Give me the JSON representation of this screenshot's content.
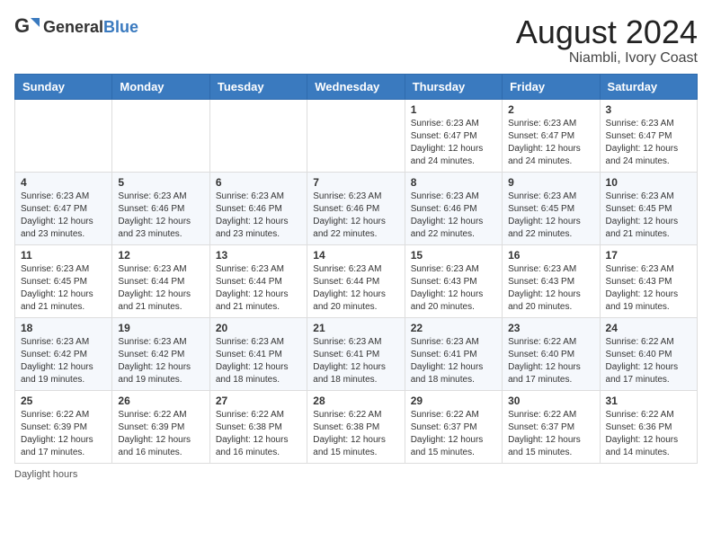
{
  "header": {
    "logo_general": "General",
    "logo_blue": "Blue",
    "main_title": "August 2024",
    "subtitle": "Niambli, Ivory Coast"
  },
  "days_of_week": [
    "Sunday",
    "Monday",
    "Tuesday",
    "Wednesday",
    "Thursday",
    "Friday",
    "Saturday"
  ],
  "weeks": [
    [
      {
        "day": "",
        "info": ""
      },
      {
        "day": "",
        "info": ""
      },
      {
        "day": "",
        "info": ""
      },
      {
        "day": "",
        "info": ""
      },
      {
        "day": "1",
        "info": "Sunrise: 6:23 AM\nSunset: 6:47 PM\nDaylight: 12 hours\nand 24 minutes."
      },
      {
        "day": "2",
        "info": "Sunrise: 6:23 AM\nSunset: 6:47 PM\nDaylight: 12 hours\nand 24 minutes."
      },
      {
        "day": "3",
        "info": "Sunrise: 6:23 AM\nSunset: 6:47 PM\nDaylight: 12 hours\nand 24 minutes."
      }
    ],
    [
      {
        "day": "4",
        "info": "Sunrise: 6:23 AM\nSunset: 6:47 PM\nDaylight: 12 hours\nand 23 minutes."
      },
      {
        "day": "5",
        "info": "Sunrise: 6:23 AM\nSunset: 6:46 PM\nDaylight: 12 hours\nand 23 minutes."
      },
      {
        "day": "6",
        "info": "Sunrise: 6:23 AM\nSunset: 6:46 PM\nDaylight: 12 hours\nand 23 minutes."
      },
      {
        "day": "7",
        "info": "Sunrise: 6:23 AM\nSunset: 6:46 PM\nDaylight: 12 hours\nand 22 minutes."
      },
      {
        "day": "8",
        "info": "Sunrise: 6:23 AM\nSunset: 6:46 PM\nDaylight: 12 hours\nand 22 minutes."
      },
      {
        "day": "9",
        "info": "Sunrise: 6:23 AM\nSunset: 6:45 PM\nDaylight: 12 hours\nand 22 minutes."
      },
      {
        "day": "10",
        "info": "Sunrise: 6:23 AM\nSunset: 6:45 PM\nDaylight: 12 hours\nand 21 minutes."
      }
    ],
    [
      {
        "day": "11",
        "info": "Sunrise: 6:23 AM\nSunset: 6:45 PM\nDaylight: 12 hours\nand 21 minutes."
      },
      {
        "day": "12",
        "info": "Sunrise: 6:23 AM\nSunset: 6:44 PM\nDaylight: 12 hours\nand 21 minutes."
      },
      {
        "day": "13",
        "info": "Sunrise: 6:23 AM\nSunset: 6:44 PM\nDaylight: 12 hours\nand 21 minutes."
      },
      {
        "day": "14",
        "info": "Sunrise: 6:23 AM\nSunset: 6:44 PM\nDaylight: 12 hours\nand 20 minutes."
      },
      {
        "day": "15",
        "info": "Sunrise: 6:23 AM\nSunset: 6:43 PM\nDaylight: 12 hours\nand 20 minutes."
      },
      {
        "day": "16",
        "info": "Sunrise: 6:23 AM\nSunset: 6:43 PM\nDaylight: 12 hours\nand 20 minutes."
      },
      {
        "day": "17",
        "info": "Sunrise: 6:23 AM\nSunset: 6:43 PM\nDaylight: 12 hours\nand 19 minutes."
      }
    ],
    [
      {
        "day": "18",
        "info": "Sunrise: 6:23 AM\nSunset: 6:42 PM\nDaylight: 12 hours\nand 19 minutes."
      },
      {
        "day": "19",
        "info": "Sunrise: 6:23 AM\nSunset: 6:42 PM\nDaylight: 12 hours\nand 19 minutes."
      },
      {
        "day": "20",
        "info": "Sunrise: 6:23 AM\nSunset: 6:41 PM\nDaylight: 12 hours\nand 18 minutes."
      },
      {
        "day": "21",
        "info": "Sunrise: 6:23 AM\nSunset: 6:41 PM\nDaylight: 12 hours\nand 18 minutes."
      },
      {
        "day": "22",
        "info": "Sunrise: 6:23 AM\nSunset: 6:41 PM\nDaylight: 12 hours\nand 18 minutes."
      },
      {
        "day": "23",
        "info": "Sunrise: 6:22 AM\nSunset: 6:40 PM\nDaylight: 12 hours\nand 17 minutes."
      },
      {
        "day": "24",
        "info": "Sunrise: 6:22 AM\nSunset: 6:40 PM\nDaylight: 12 hours\nand 17 minutes."
      }
    ],
    [
      {
        "day": "25",
        "info": "Sunrise: 6:22 AM\nSunset: 6:39 PM\nDaylight: 12 hours\nand 17 minutes."
      },
      {
        "day": "26",
        "info": "Sunrise: 6:22 AM\nSunset: 6:39 PM\nDaylight: 12 hours\nand 16 minutes."
      },
      {
        "day": "27",
        "info": "Sunrise: 6:22 AM\nSunset: 6:38 PM\nDaylight: 12 hours\nand 16 minutes."
      },
      {
        "day": "28",
        "info": "Sunrise: 6:22 AM\nSunset: 6:38 PM\nDaylight: 12 hours\nand 15 minutes."
      },
      {
        "day": "29",
        "info": "Sunrise: 6:22 AM\nSunset: 6:37 PM\nDaylight: 12 hours\nand 15 minutes."
      },
      {
        "day": "30",
        "info": "Sunrise: 6:22 AM\nSunset: 6:37 PM\nDaylight: 12 hours\nand 15 minutes."
      },
      {
        "day": "31",
        "info": "Sunrise: 6:22 AM\nSunset: 6:36 PM\nDaylight: 12 hours\nand 14 minutes."
      }
    ]
  ],
  "legend": {
    "daylight_hours_label": "Daylight hours"
  }
}
